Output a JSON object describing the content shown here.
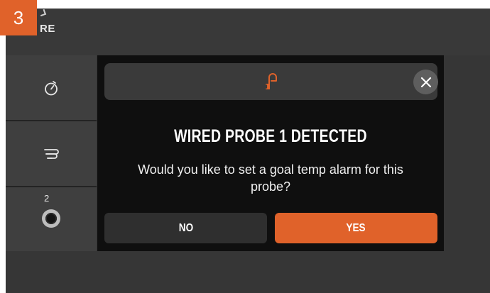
{
  "step_badge": "3",
  "header": {
    "title_fragment": "RE"
  },
  "sidebar": {
    "items": [
      {
        "icon": "timer-icon"
      },
      {
        "icon": "smoke-icon"
      },
      {
        "icon": "probe-jack-icon",
        "label": "2"
      }
    ]
  },
  "dialog": {
    "icon": "probe-alarm-icon",
    "title": "WIRED PROBE 1 DETECTED",
    "message": "Would you like to set a goal temp alarm for this probe?",
    "no_label": "NO",
    "yes_label": "YES"
  },
  "colors": {
    "accent": "#e0622a",
    "screen_bg": "#363636",
    "sidebar_bg": "#3f3f3f",
    "dialog_bg": "#0f0f0f",
    "dialog_header_bg": "#3a3a3a",
    "no_button_bg": "#2f2f2f"
  }
}
